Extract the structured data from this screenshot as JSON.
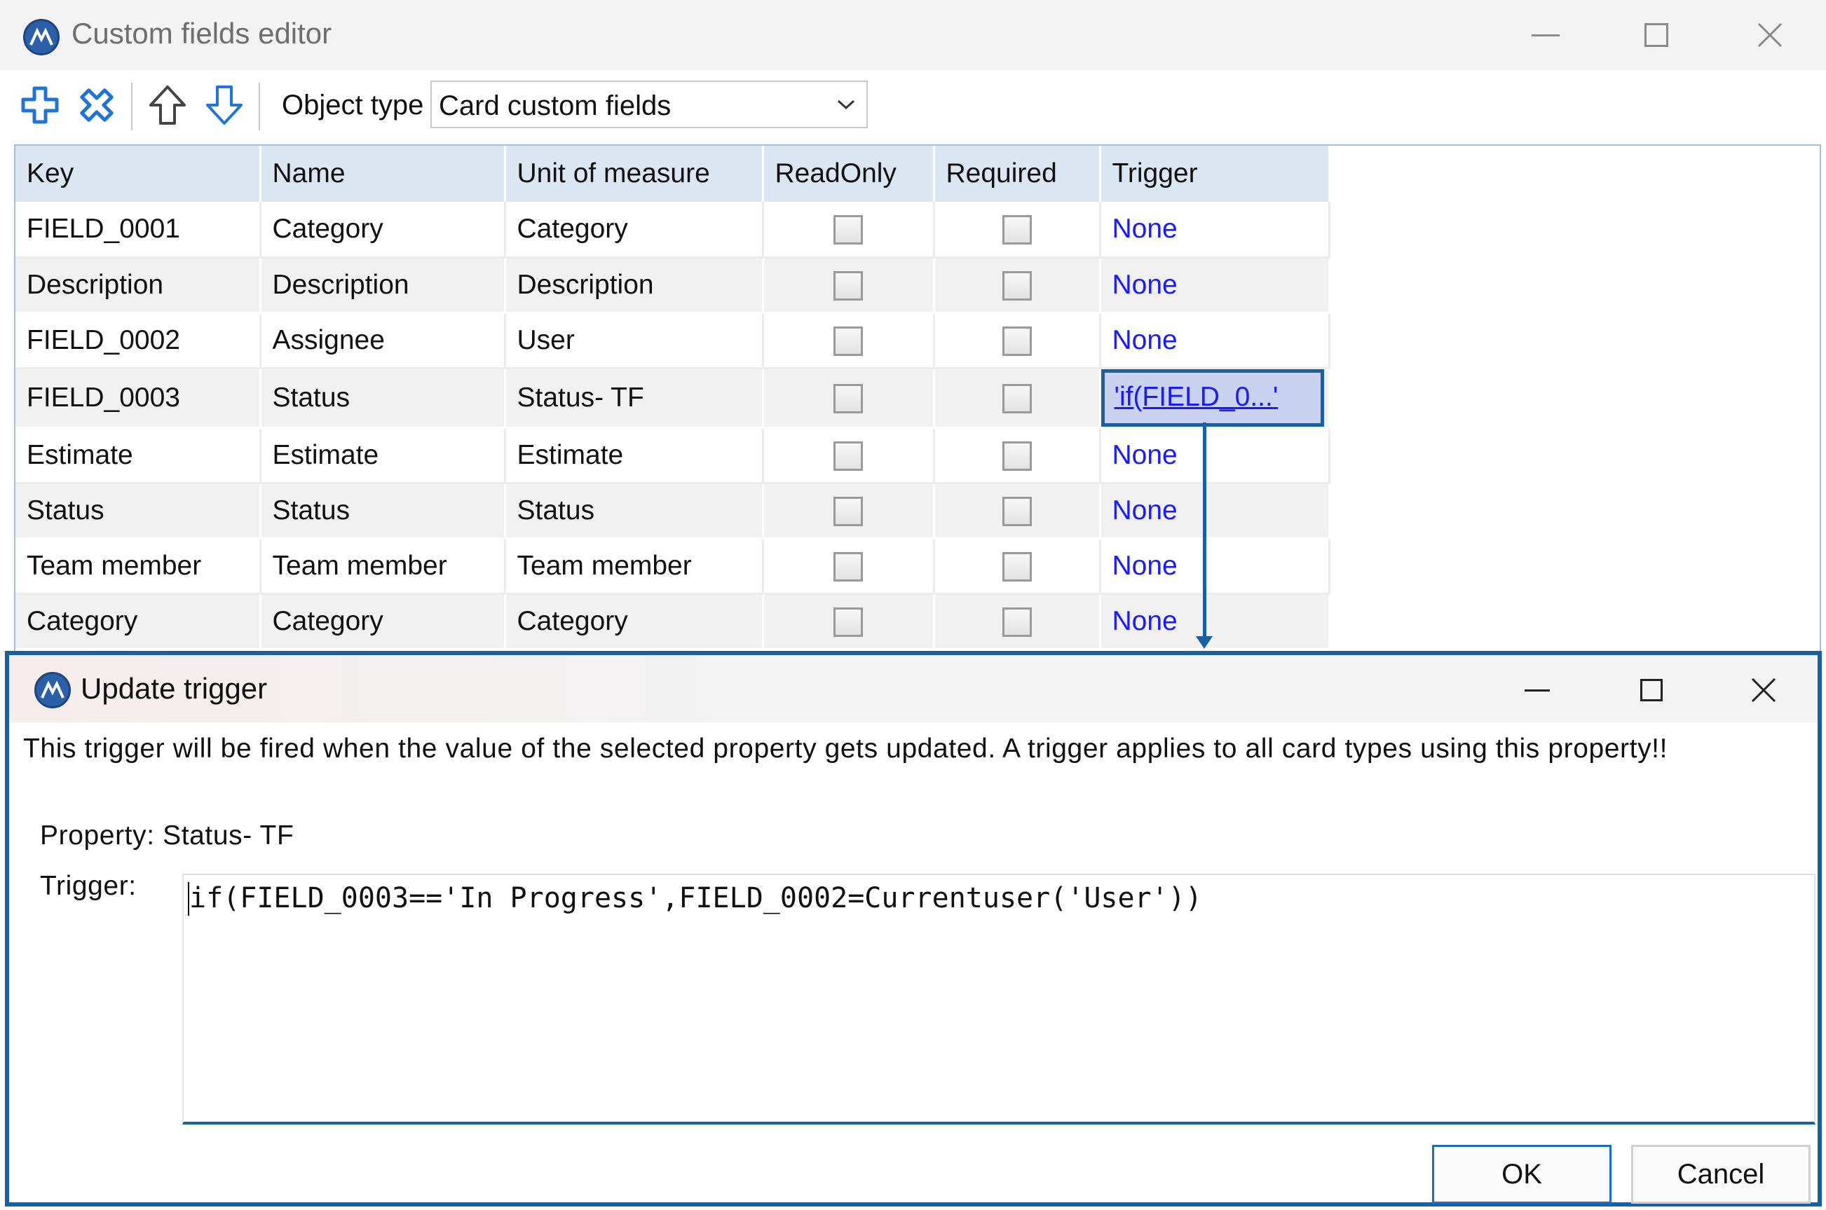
{
  "window": {
    "title": "Custom fields editor"
  },
  "toolbar": {
    "add_icon": "plus-icon",
    "delete_icon": "delete-icon",
    "move_up_icon": "arrow-up-icon",
    "move_down_icon": "arrow-down-icon",
    "object_type_label": "Object type",
    "object_type_value": "Card custom fields"
  },
  "grid": {
    "columns": [
      "Key",
      "Name",
      "Unit of measure",
      "ReadOnly",
      "Required",
      "Trigger"
    ],
    "rows": [
      {
        "key": "FIELD_0001",
        "name": "Category",
        "unit": "Category",
        "readonly": false,
        "required": false,
        "trigger": "None"
      },
      {
        "key": "Description",
        "name": "Description",
        "unit": "Description",
        "readonly": false,
        "required": false,
        "trigger": "None"
      },
      {
        "key": "FIELD_0002",
        "name": "Assignee",
        "unit": "User",
        "readonly": false,
        "required": false,
        "trigger": "None"
      },
      {
        "key": "FIELD_0003",
        "name": "Status",
        "unit": "Status- TF",
        "readonly": false,
        "required": false,
        "trigger": "'if(FIELD_0...'"
      },
      {
        "key": "Estimate",
        "name": "Estimate",
        "unit": "Estimate",
        "readonly": false,
        "required": false,
        "trigger": "None"
      },
      {
        "key": "Status",
        "name": "Status",
        "unit": "Status",
        "readonly": false,
        "required": false,
        "trigger": "None"
      },
      {
        "key": "Team member",
        "name": "Team member",
        "unit": "Team member",
        "readonly": false,
        "required": false,
        "trigger": "None"
      },
      {
        "key": "Category",
        "name": "Category",
        "unit": "Category",
        "readonly": false,
        "required": false,
        "trigger": "None"
      }
    ]
  },
  "dialog": {
    "title": "Update trigger",
    "description": "This trigger will be fired when the value of the selected property gets updated. A trigger applies to all card types using this property!!",
    "property_label": "Property:",
    "property_value": "Status- TF",
    "trigger_label": "Trigger:",
    "trigger_value": "if(FIELD_0003=='In Progress',FIELD_0002=Currentuser('User'))",
    "ok_label": "OK",
    "cancel_label": "Cancel"
  },
  "colors": {
    "accent": "#1a5fa0",
    "link": "#1a1aff",
    "header_bg": "#dbe6f2"
  }
}
